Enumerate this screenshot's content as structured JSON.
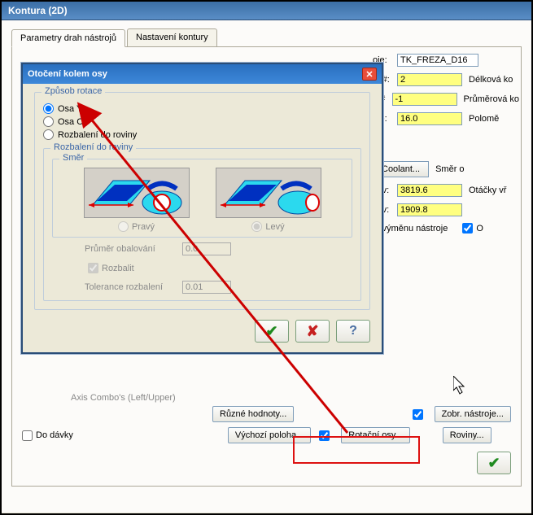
{
  "window": {
    "title": "Kontura (2D)"
  },
  "tabs": [
    {
      "label": "Parametry drah nástrojů"
    },
    {
      "label": "Nastavení kontury"
    }
  ],
  "right": {
    "tool_label_suffix": "oje:",
    "tool_value": "TK_FREZA_D16",
    "num1_label": "oj #:",
    "num1_value": "2",
    "num1_trail": "Délková ko",
    "num2_label": "a #",
    "num2_value": "-1",
    "num2_trail": "Průměrová ko",
    "dia_label": "oje:",
    "dia_value": "16.0",
    "dia_trail": "Polomě",
    "coolant_label": "Coolant...",
    "coolant_trail": "Směr o",
    "feed1_label": "suv:",
    "feed1_value": "3819.6",
    "feed1_trail": "Otáčky vř",
    "feed2_label": "suv:",
    "feed2_value": "1909.8",
    "swap_label": "tit výměnu nástroje",
    "o_checkbox": "O"
  },
  "dialog": {
    "title": "Otočení kolem osy",
    "group_rotation": "Způsob rotace",
    "radio_y": "Osa Y",
    "radio_c": "Osa C",
    "radio_unroll": "Rozbalení do roviny",
    "subgroup": "Rozbalení do roviny",
    "sub_dir": "Směr",
    "dir_right": "Pravý",
    "dir_left": "Levý",
    "wrap_dia_label": "Průměr obalování",
    "wrap_dia_value": "0.0",
    "unroll_check": "Rozbalit",
    "tol_label": "Tolerance rozbalení",
    "tol_value": "0.01"
  },
  "bottom": {
    "axis_combo": "Axis Combo's (Left/Upper)",
    "diff_values": "Různé hodnoty...",
    "show_tools": "Zobr. nástroje...",
    "batch": "Do dávky",
    "home_pos": "Výchozí poloha...",
    "rotary": "Rotační osy...",
    "planes": "Roviny..."
  }
}
